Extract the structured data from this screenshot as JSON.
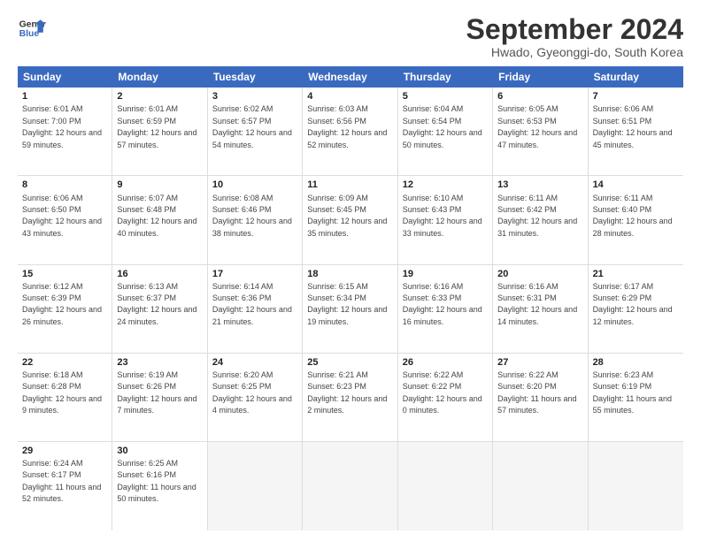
{
  "logo": {
    "line1": "General",
    "line2": "Blue"
  },
  "title": "September 2024",
  "location": "Hwado, Gyeonggi-do, South Korea",
  "days": [
    "Sunday",
    "Monday",
    "Tuesday",
    "Wednesday",
    "Thursday",
    "Friday",
    "Saturday"
  ],
  "weeks": [
    [
      {
        "day": "1",
        "sunrise": "6:01 AM",
        "sunset": "7:00 PM",
        "daylight": "12 hours and 59 minutes."
      },
      {
        "day": "2",
        "sunrise": "6:01 AM",
        "sunset": "6:59 PM",
        "daylight": "12 hours and 57 minutes."
      },
      {
        "day": "3",
        "sunrise": "6:02 AM",
        "sunset": "6:57 PM",
        "daylight": "12 hours and 54 minutes."
      },
      {
        "day": "4",
        "sunrise": "6:03 AM",
        "sunset": "6:56 PM",
        "daylight": "12 hours and 52 minutes."
      },
      {
        "day": "5",
        "sunrise": "6:04 AM",
        "sunset": "6:54 PM",
        "daylight": "12 hours and 50 minutes."
      },
      {
        "day": "6",
        "sunrise": "6:05 AM",
        "sunset": "6:53 PM",
        "daylight": "12 hours and 47 minutes."
      },
      {
        "day": "7",
        "sunrise": "6:06 AM",
        "sunset": "6:51 PM",
        "daylight": "12 hours and 45 minutes."
      }
    ],
    [
      {
        "day": "8",
        "sunrise": "6:06 AM",
        "sunset": "6:50 PM",
        "daylight": "12 hours and 43 minutes."
      },
      {
        "day": "9",
        "sunrise": "6:07 AM",
        "sunset": "6:48 PM",
        "daylight": "12 hours and 40 minutes."
      },
      {
        "day": "10",
        "sunrise": "6:08 AM",
        "sunset": "6:46 PM",
        "daylight": "12 hours and 38 minutes."
      },
      {
        "day": "11",
        "sunrise": "6:09 AM",
        "sunset": "6:45 PM",
        "daylight": "12 hours and 35 minutes."
      },
      {
        "day": "12",
        "sunrise": "6:10 AM",
        "sunset": "6:43 PM",
        "daylight": "12 hours and 33 minutes."
      },
      {
        "day": "13",
        "sunrise": "6:11 AM",
        "sunset": "6:42 PM",
        "daylight": "12 hours and 31 minutes."
      },
      {
        "day": "14",
        "sunrise": "6:11 AM",
        "sunset": "6:40 PM",
        "daylight": "12 hours and 28 minutes."
      }
    ],
    [
      {
        "day": "15",
        "sunrise": "6:12 AM",
        "sunset": "6:39 PM",
        "daylight": "12 hours and 26 minutes."
      },
      {
        "day": "16",
        "sunrise": "6:13 AM",
        "sunset": "6:37 PM",
        "daylight": "12 hours and 24 minutes."
      },
      {
        "day": "17",
        "sunrise": "6:14 AM",
        "sunset": "6:36 PM",
        "daylight": "12 hours and 21 minutes."
      },
      {
        "day": "18",
        "sunrise": "6:15 AM",
        "sunset": "6:34 PM",
        "daylight": "12 hours and 19 minutes."
      },
      {
        "day": "19",
        "sunrise": "6:16 AM",
        "sunset": "6:33 PM",
        "daylight": "12 hours and 16 minutes."
      },
      {
        "day": "20",
        "sunrise": "6:16 AM",
        "sunset": "6:31 PM",
        "daylight": "12 hours and 14 minutes."
      },
      {
        "day": "21",
        "sunrise": "6:17 AM",
        "sunset": "6:29 PM",
        "daylight": "12 hours and 12 minutes."
      }
    ],
    [
      {
        "day": "22",
        "sunrise": "6:18 AM",
        "sunset": "6:28 PM",
        "daylight": "12 hours and 9 minutes."
      },
      {
        "day": "23",
        "sunrise": "6:19 AM",
        "sunset": "6:26 PM",
        "daylight": "12 hours and 7 minutes."
      },
      {
        "day": "24",
        "sunrise": "6:20 AM",
        "sunset": "6:25 PM",
        "daylight": "12 hours and 4 minutes."
      },
      {
        "day": "25",
        "sunrise": "6:21 AM",
        "sunset": "6:23 PM",
        "daylight": "12 hours and 2 minutes."
      },
      {
        "day": "26",
        "sunrise": "6:22 AM",
        "sunset": "6:22 PM",
        "daylight": "12 hours and 0 minutes."
      },
      {
        "day": "27",
        "sunrise": "6:22 AM",
        "sunset": "6:20 PM",
        "daylight": "11 hours and 57 minutes."
      },
      {
        "day": "28",
        "sunrise": "6:23 AM",
        "sunset": "6:19 PM",
        "daylight": "11 hours and 55 minutes."
      }
    ],
    [
      {
        "day": "29",
        "sunrise": "6:24 AM",
        "sunset": "6:17 PM",
        "daylight": "11 hours and 52 minutes."
      },
      {
        "day": "30",
        "sunrise": "6:25 AM",
        "sunset": "6:16 PM",
        "daylight": "11 hours and 50 minutes."
      },
      null,
      null,
      null,
      null,
      null
    ]
  ]
}
